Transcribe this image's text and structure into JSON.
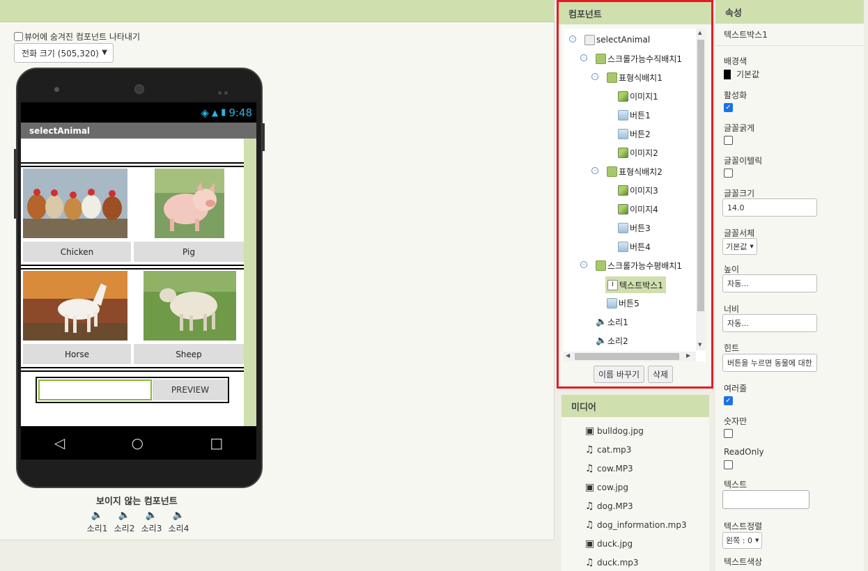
{
  "viewer": {
    "show_hidden_label": "뷰어에 숨겨진 컴포넌트 나타내기",
    "size_select": "전화 크기 (505,320)",
    "status_time": "9:48",
    "screen_title": "selectAnimal",
    "buttons": [
      "Chicken",
      "Pig",
      "Horse",
      "Sheep"
    ],
    "preview_button": "PREVIEW",
    "invisible_title": "보이지 않는 컴포넌트",
    "invisible_items": [
      "소리1",
      "소리2",
      "소리3",
      "소리4"
    ]
  },
  "components": {
    "title": "컴포넌트",
    "tree": [
      {
        "label": "selectAnimal",
        "icon": "screen-icon"
      },
      {
        "label": "스크롤가능수직배치1",
        "icon": "vertical-scroll-arrangement-icon"
      },
      {
        "label": "표형식배치1",
        "icon": "table-arrangement-icon"
      },
      {
        "label": "이미지1",
        "icon": "image-icon"
      },
      {
        "label": "버튼1",
        "icon": "button-icon"
      },
      {
        "label": "버튼2",
        "icon": "button-icon"
      },
      {
        "label": "이미지2",
        "icon": "image-icon"
      },
      {
        "label": "표형식배치2",
        "icon": "table-arrangement-icon"
      },
      {
        "label": "이미지3",
        "icon": "image-icon"
      },
      {
        "label": "이미지4",
        "icon": "image-icon"
      },
      {
        "label": "버튼3",
        "icon": "button-icon"
      },
      {
        "label": "버튼4",
        "icon": "button-icon"
      },
      {
        "label": "스크롤가능수평배치1",
        "icon": "horizontal-scroll-arrangement-icon"
      },
      {
        "label": "텍스트박스1",
        "icon": "textbox-icon"
      },
      {
        "label": "버튼5",
        "icon": "button-icon"
      },
      {
        "label": "소리1",
        "icon": "sound-icon"
      },
      {
        "label": "소리2",
        "icon": "sound-icon"
      }
    ],
    "rename_button": "이름 바꾸기",
    "delete_button": "삭제"
  },
  "media": {
    "title": "미디어",
    "items": [
      {
        "label": "bulldog.jpg",
        "icon": "image-file-icon"
      },
      {
        "label": "cat.mp3",
        "icon": "music-file-icon"
      },
      {
        "label": "cow.MP3",
        "icon": "music-file-icon"
      },
      {
        "label": "cow.jpg",
        "icon": "image-file-icon"
      },
      {
        "label": "dog.MP3",
        "icon": "music-file-icon"
      },
      {
        "label": "dog_information.mp3",
        "icon": "music-file-icon"
      },
      {
        "label": "duck.jpg",
        "icon": "image-file-icon"
      },
      {
        "label": "duck.mp3",
        "icon": "music-file-icon"
      }
    ]
  },
  "properties": {
    "title": "속성",
    "component_name": "텍스트박스1",
    "background_label": "배경색",
    "background_value": "기본값",
    "enabled_label": "활성화",
    "bold_label": "글꼴굵게",
    "italic_label": "글꼴이텔릭",
    "fontsize_label": "글꼴크기",
    "fontsize_value": "14.0",
    "typeface_label": "글꼴서체",
    "typeface_value": "기본값",
    "height_label": "높이",
    "height_value": "자동...",
    "width_label": "너비",
    "width_value": "자동...",
    "hint_label": "힌트",
    "hint_value": "버튼을 누르면 동물에 대한",
    "multiline_label": "여러줄",
    "numbers_only_label": "숫자만",
    "readonly_label": "ReadOnly",
    "text_label": "텍스트",
    "text_value": "",
    "text_align_label": "텍스트정렬",
    "text_align_value": "왼쪽 : 0",
    "text_color_label": "텍스트색상"
  },
  "colors": {
    "panel_header": "#cfdfae",
    "selection_border": "#e51b24",
    "checkbox_on": "#1a73e8"
  }
}
